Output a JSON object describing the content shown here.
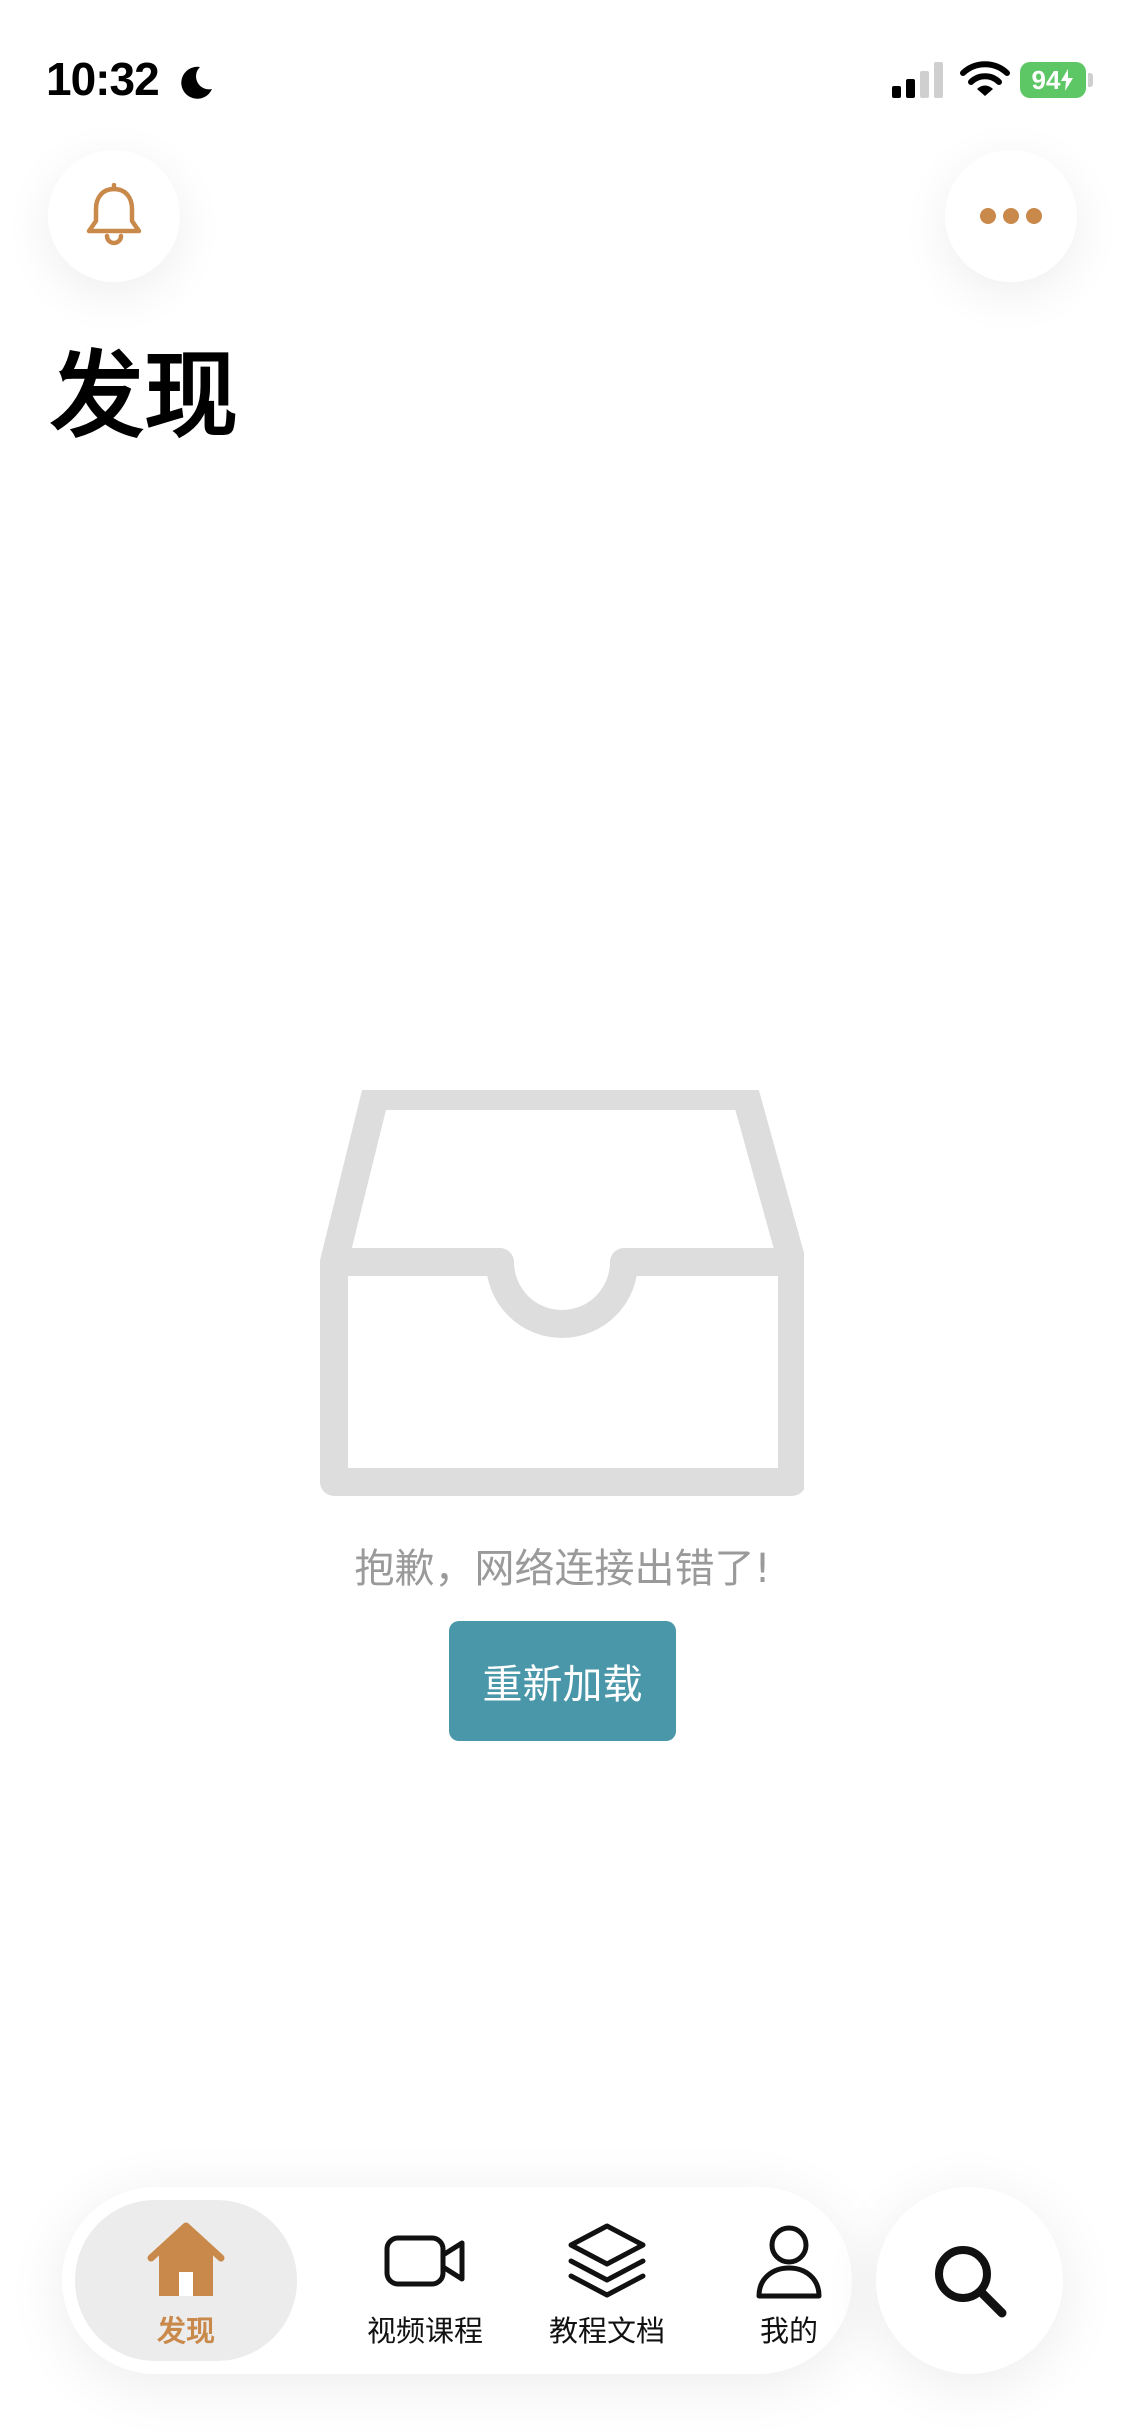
{
  "status_bar": {
    "time": "10:32",
    "battery": "94"
  },
  "header": {
    "title": "发现",
    "bell_icon": "bell-icon",
    "more_icon": "more-dots-icon"
  },
  "empty_state": {
    "icon": "empty-inbox-icon",
    "message": "抱歉，网络连接出错了!",
    "reload_label": "重新加载"
  },
  "tabs": [
    {
      "label": "发现",
      "icon": "home-icon",
      "active": true
    },
    {
      "label": "视频课程",
      "icon": "video-camera-icon",
      "active": false
    },
    {
      "label": "教程文档",
      "icon": "layers-icon",
      "active": false
    },
    {
      "label": "我的",
      "icon": "user-icon",
      "active": false
    }
  ],
  "search_icon": "search-icon",
  "colors": {
    "accent": "#c8894a",
    "button": "#4a97a9",
    "muted_text": "#9a9a9a",
    "icon_gray": "#dddddd",
    "battery_green": "#5ec765"
  }
}
